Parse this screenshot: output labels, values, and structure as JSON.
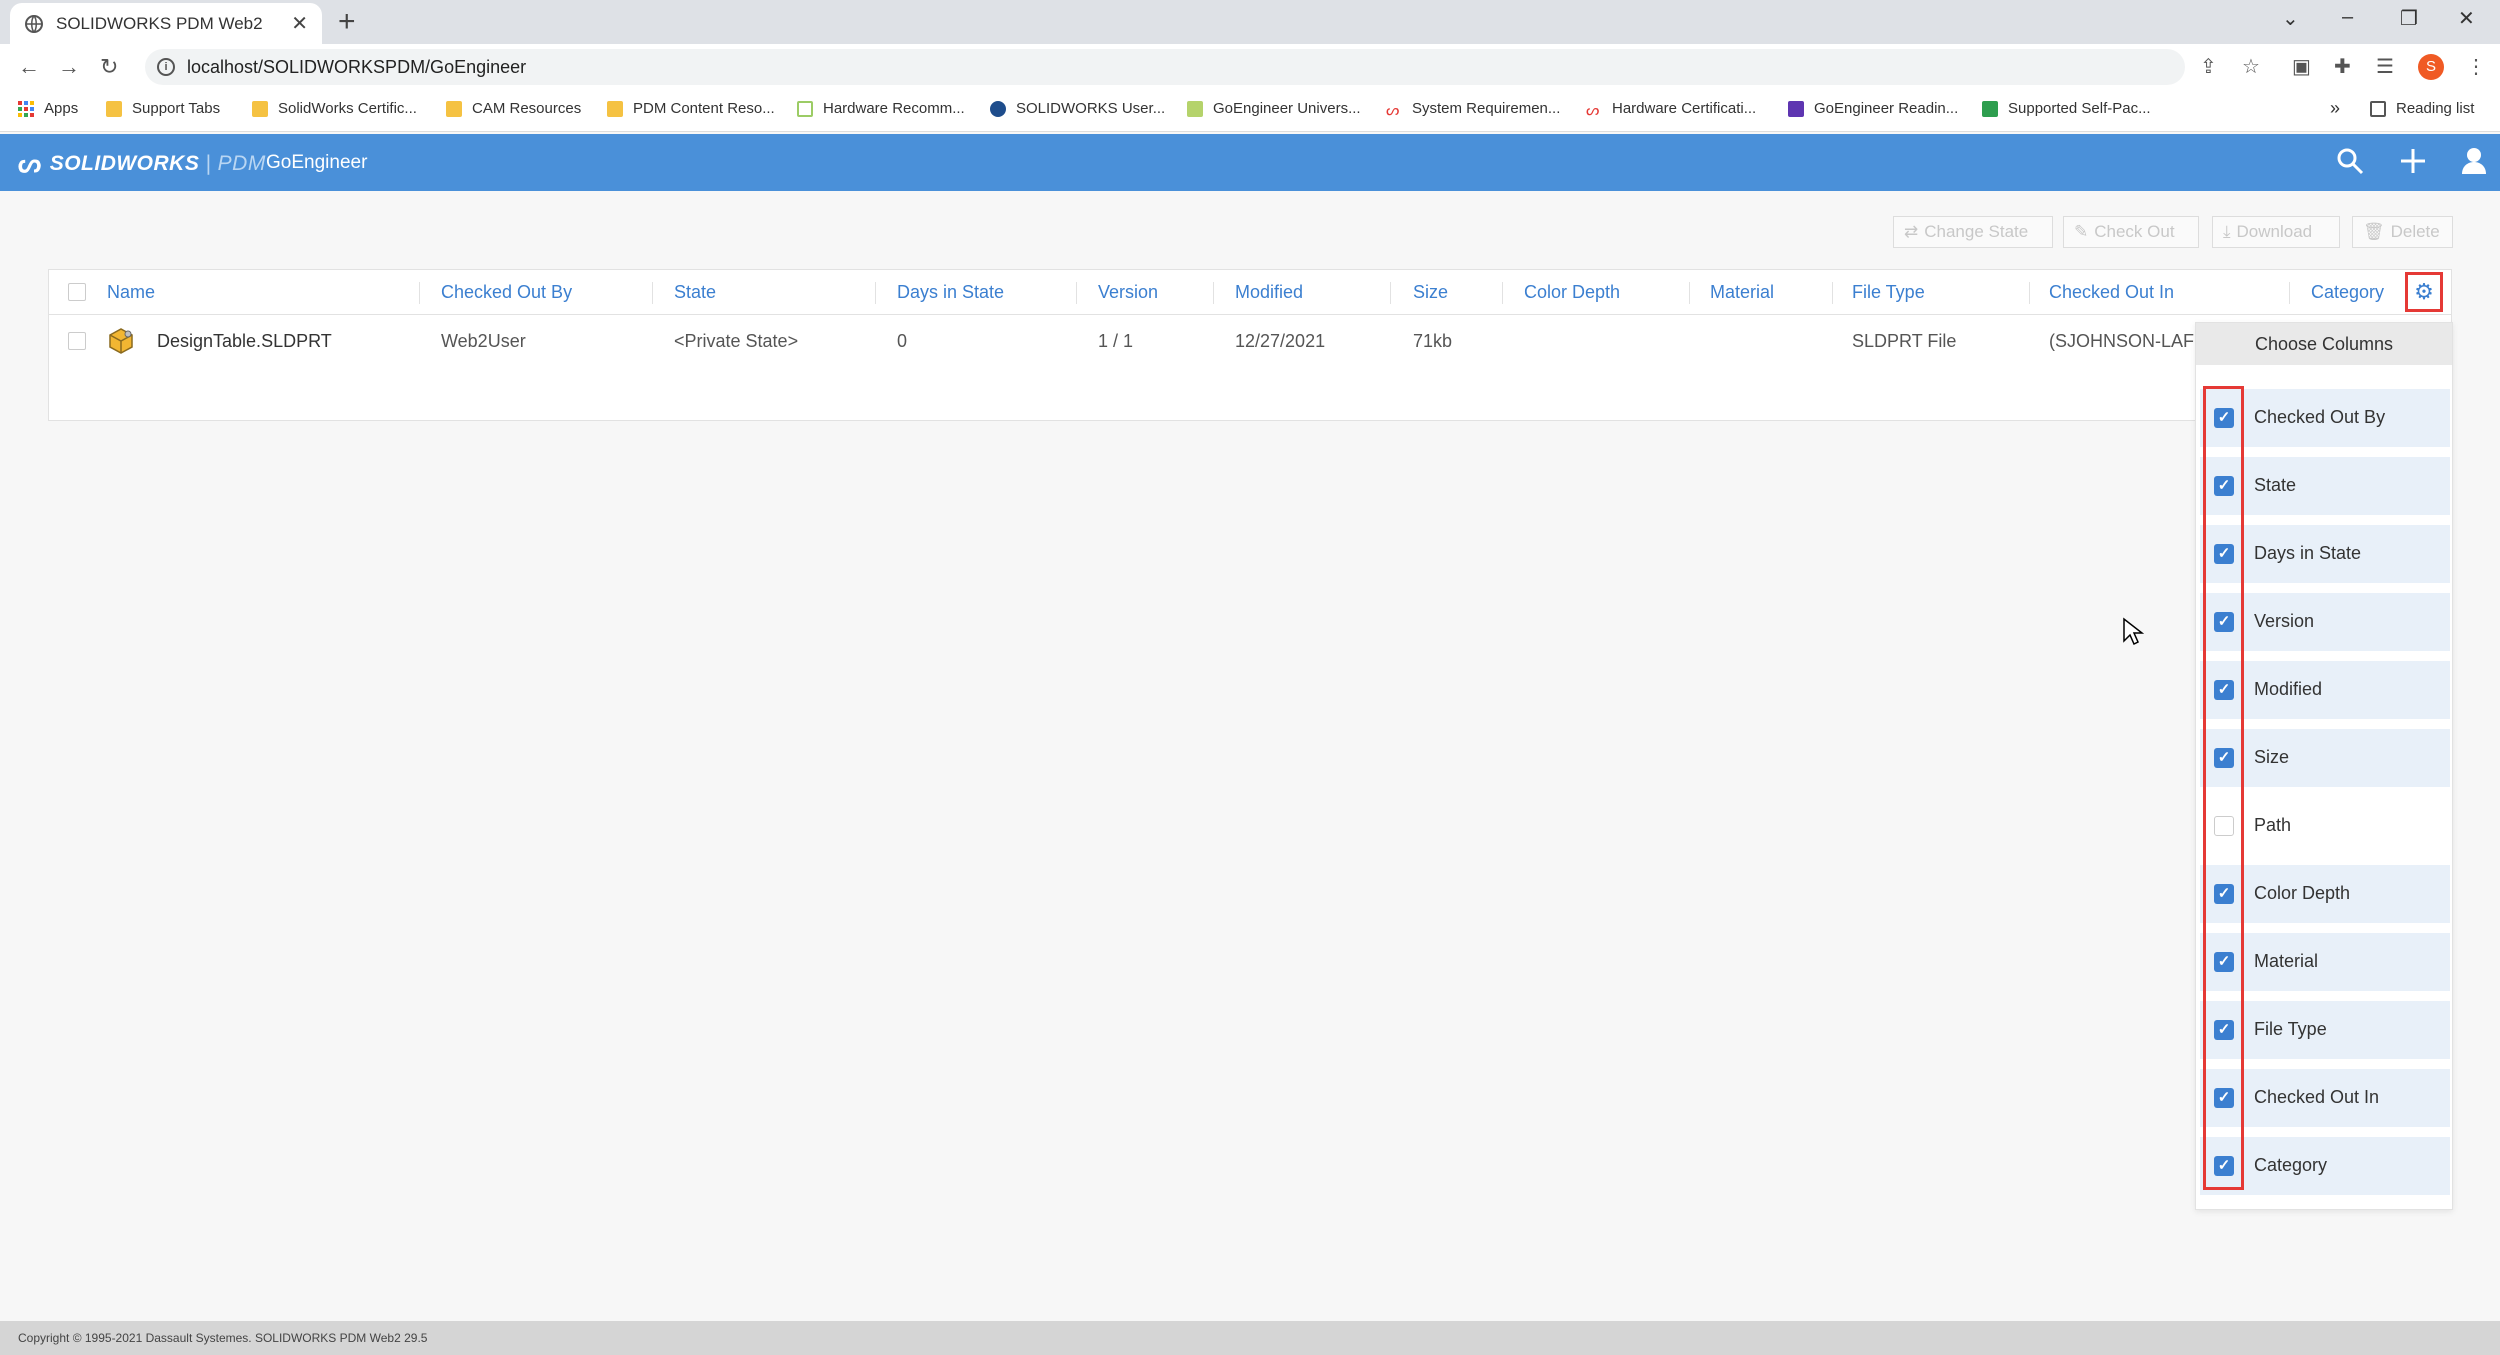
{
  "browser": {
    "tab_title": "SOLIDWORKS PDM Web2",
    "url": "localhost/SOLIDWORKSPDM/GoEngineer",
    "profile_initial": "S",
    "bookmarks": [
      "Apps",
      "Support Tabs",
      "SolidWorks Certific...",
      "CAM Resources",
      "PDM Content Reso...",
      "Hardware Recomm...",
      "SOLIDWORKS User...",
      "GoEngineer Univers...",
      "System Requiremen...",
      "Hardware Certificati...",
      "GoEngineer Readin...",
      "Supported Self-Pac..."
    ],
    "reading_list": "Reading list",
    "overflow": "»"
  },
  "app": {
    "brand": "SOLIDWORKS",
    "brand_sub": "PDM",
    "vault": "GoEngineer",
    "accent": "#4a90d9"
  },
  "actions": {
    "change_state": "Change State",
    "check_out": "Check Out",
    "download": "Download",
    "delete": "Delete"
  },
  "grid": {
    "headers": [
      "Name",
      "Checked Out By",
      "State",
      "Days in State",
      "Version",
      "Modified",
      "Size",
      "Color Depth",
      "Material",
      "File Type",
      "Checked Out In",
      "Category"
    ],
    "row": {
      "name": "DesignTable.SLDPRT",
      "checked_out_by": "Web2User",
      "state": "<Private State>",
      "days_in_state": "0",
      "version": "1 / 1",
      "modified": "12/27/2021",
      "size": "71kb",
      "file_type": "SLDPRT File",
      "checked_out_in": "(SJOHNSON-LAF"
    }
  },
  "columns_panel": {
    "title": "Choose Columns",
    "options": [
      {
        "label": "Checked Out By",
        "checked": true
      },
      {
        "label": "State",
        "checked": true
      },
      {
        "label": "Days in State",
        "checked": true
      },
      {
        "label": "Version",
        "checked": true
      },
      {
        "label": "Modified",
        "checked": true
      },
      {
        "label": "Size",
        "checked": true
      },
      {
        "label": "Path",
        "checked": false
      },
      {
        "label": "Color Depth",
        "checked": true
      },
      {
        "label": "Material",
        "checked": true
      },
      {
        "label": "File Type",
        "checked": true
      },
      {
        "label": "Checked Out In",
        "checked": true
      },
      {
        "label": "Category",
        "checked": true
      }
    ]
  },
  "footer": {
    "copyright": "Copyright © 1995-2021 Dassault Systemes. SOLIDWORKS PDM Web2 29.5"
  }
}
